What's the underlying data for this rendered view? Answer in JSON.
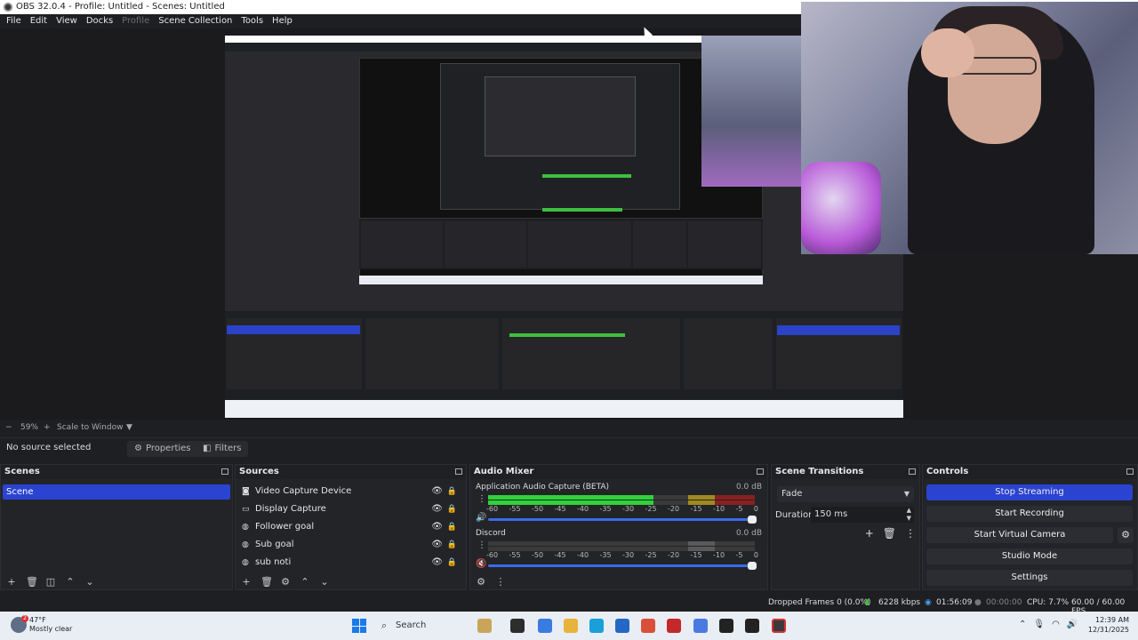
{
  "window": {
    "title": "OBS 32.0.4 - Profile: Untitled - Scenes: Untitled"
  },
  "menu": {
    "items": [
      {
        "label": "File",
        "enabled": true
      },
      {
        "label": "Edit",
        "enabled": true
      },
      {
        "label": "View",
        "enabled": true
      },
      {
        "label": "Docks",
        "enabled": true
      },
      {
        "label": "Profile",
        "enabled": false
      },
      {
        "label": "Scene Collection",
        "enabled": true
      },
      {
        "label": "Tools",
        "enabled": true
      },
      {
        "label": "Help",
        "enabled": true
      }
    ]
  },
  "preview": {
    "zoom": "59%",
    "scale_mode": "Scale to Window"
  },
  "source_toolbar": {
    "no_source": "No source selected",
    "properties": "Properties",
    "filters": "Filters"
  },
  "scenes": {
    "title": "Scenes",
    "items": [
      "Scene"
    ],
    "selected": "Scene"
  },
  "sources": {
    "title": "Sources",
    "items": [
      {
        "name": "Video Capture Device",
        "icon": "camera-icon"
      },
      {
        "name": "Display Capture",
        "icon": "monitor-icon"
      },
      {
        "name": "Follower goal",
        "icon": "globe-icon"
      },
      {
        "name": "Sub goal",
        "icon": "globe-icon"
      },
      {
        "name": "sub noti",
        "icon": "globe-icon"
      }
    ]
  },
  "audio_mixer": {
    "title": "Audio Mixer",
    "ticks": [
      "-60",
      "-55",
      "-50",
      "-45",
      "-40",
      "-35",
      "-30",
      "-25",
      "-20",
      "-15",
      "-10",
      "-5",
      "0"
    ],
    "channels": [
      {
        "name": "Application Audio Capture (BETA)",
        "db": "0.0 dB",
        "level": 0.62,
        "muted": false
      },
      {
        "name": "Discord",
        "db": "0.0 dB",
        "level": 0.0,
        "muted": true
      }
    ]
  },
  "scene_transitions": {
    "title": "Scene Transitions",
    "transition": "Fade",
    "duration_label": "Duration",
    "duration": "150 ms"
  },
  "controls": {
    "title": "Controls",
    "stop_streaming": "Stop Streaming",
    "start_recording": "Start Recording",
    "start_virtual_camera": "Start Virtual Camera",
    "studio_mode": "Studio Mode",
    "settings": "Settings"
  },
  "status": {
    "dropped_frames": "Dropped Frames 0 (0.0%)",
    "bitrate": "6228 kbps",
    "stream_time": "01:56:09",
    "record_time": "00:00:00",
    "cpu": "CPU: 7.7%",
    "fps": "60.00 / 60.00 FPS"
  },
  "taskbar": {
    "weather_temp": "47°F",
    "weather_desc": "Mostly clear",
    "weather_badge": "2",
    "search": "Search",
    "time": "12:39 AM",
    "date": "12/31/2025"
  },
  "colors": {
    "accent": "#2b43d1",
    "meter_green": "#2fd13a",
    "bg": "#1e1f22"
  }
}
